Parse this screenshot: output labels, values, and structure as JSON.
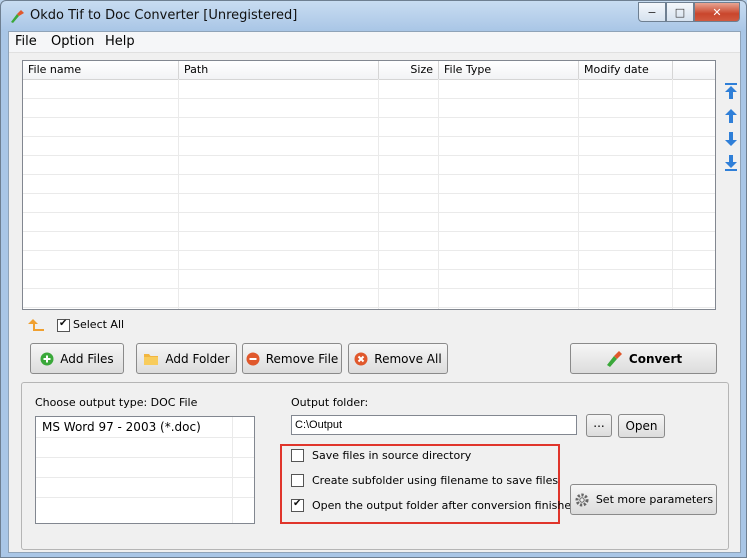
{
  "window": {
    "title": "Okdo Tif to Doc Converter [Unregistered]",
    "controls": {
      "minimize": "−",
      "maximize": "□",
      "close": "✕"
    }
  },
  "menu": [
    "File",
    "Option",
    "Help"
  ],
  "file_list": {
    "columns": [
      "File name",
      "Path",
      "Size",
      "File Type",
      "Modify date"
    ],
    "rows": []
  },
  "select_all": {
    "label": "Select All",
    "checked": true
  },
  "buttons": {
    "add_files": "Add Files",
    "add_folder": "Add Folder",
    "remove_file": "Remove File",
    "remove_all": "Remove All",
    "convert": "Convert",
    "browse": "...",
    "open": "Open",
    "set_more": "Set more parameters"
  },
  "output_type": {
    "label": "Choose output type:",
    "value": "DOC File",
    "options": [
      "MS Word 97 - 2003 (*.doc)"
    ]
  },
  "output_folder": {
    "label": "Output folder:",
    "value": "C:\\Output"
  },
  "options": {
    "save_in_source": {
      "label": "Save files in source directory",
      "checked": false
    },
    "create_subfolder": {
      "label": "Create subfolder using filename to save files",
      "checked": false
    },
    "open_after": {
      "label": "Open the output folder after conversion finished",
      "checked": true
    }
  },
  "colors": {
    "highlight_box": "#e0352b",
    "arrow_blue": "#2f7fd8",
    "add_green": "#3aa83a",
    "remove_red": "#e0582c"
  }
}
